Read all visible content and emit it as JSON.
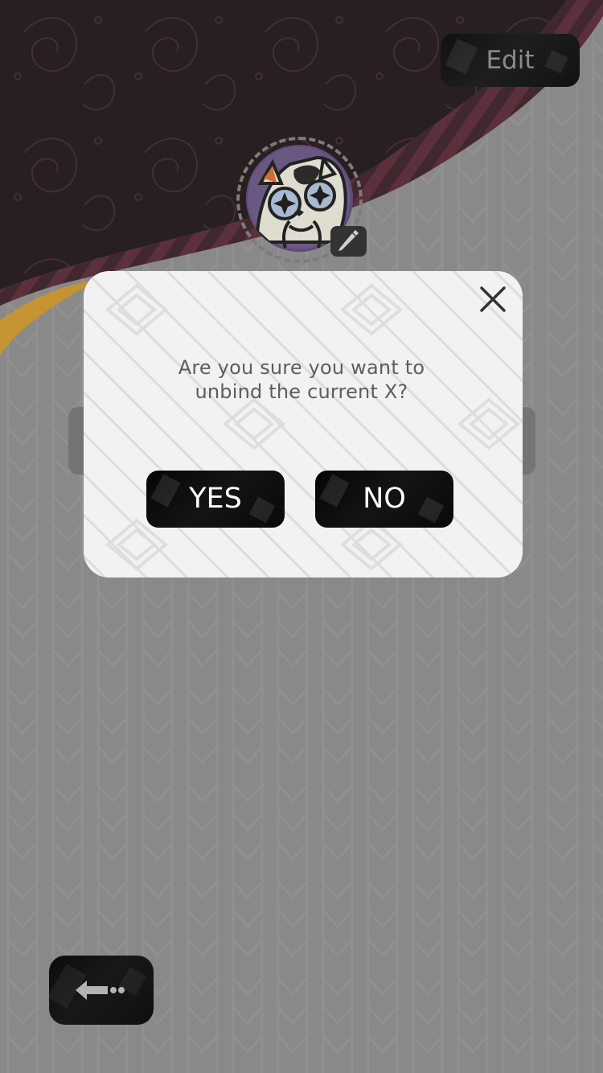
{
  "header": {
    "edit_label": "Edit"
  },
  "dialog": {
    "message": "Are you sure you want to\nunbind the current X?",
    "yes_label": "YES",
    "no_label": "NO"
  },
  "icons": {
    "avatar": "cat-avatar",
    "edit_avatar": "pencil-icon",
    "close": "close-icon",
    "back": "back-arrow-icon"
  },
  "colors": {
    "overlay": "#8e8e8e",
    "top_panel": "#2b1f22",
    "modal_bg": "#f1f1f1",
    "button_dark": "#111111",
    "accent_orange": "#d79a22",
    "accent_rose": "#5a2c36"
  }
}
